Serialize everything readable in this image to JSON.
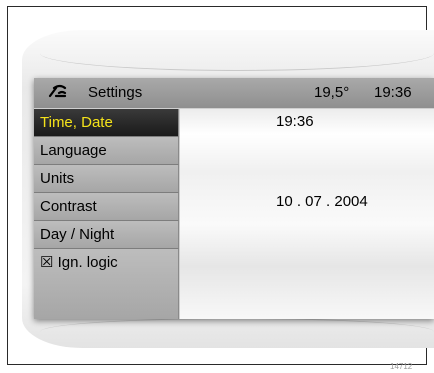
{
  "header": {
    "title": "Settings",
    "temperature": "19,5°",
    "clock": "19:36",
    "icon": "phone-handset-icon"
  },
  "menu": {
    "items": [
      {
        "label": "Time, Date",
        "selected": true
      },
      {
        "label": "Language",
        "selected": false
      },
      {
        "label": "Units",
        "selected": false
      },
      {
        "label": "Contrast",
        "selected": false
      },
      {
        "label": "Day / Night",
        "selected": false
      },
      {
        "label": "☒ Ign. logic",
        "selected": false
      }
    ]
  },
  "content": {
    "time_value": "19:36",
    "date_value": "10 . 07 . 2004"
  },
  "figure_code": "14712",
  "colors": {
    "selected_text": "#f4e21a",
    "selected_bg": "#1f1f1f",
    "header_bg": "#9c9c9c"
  }
}
